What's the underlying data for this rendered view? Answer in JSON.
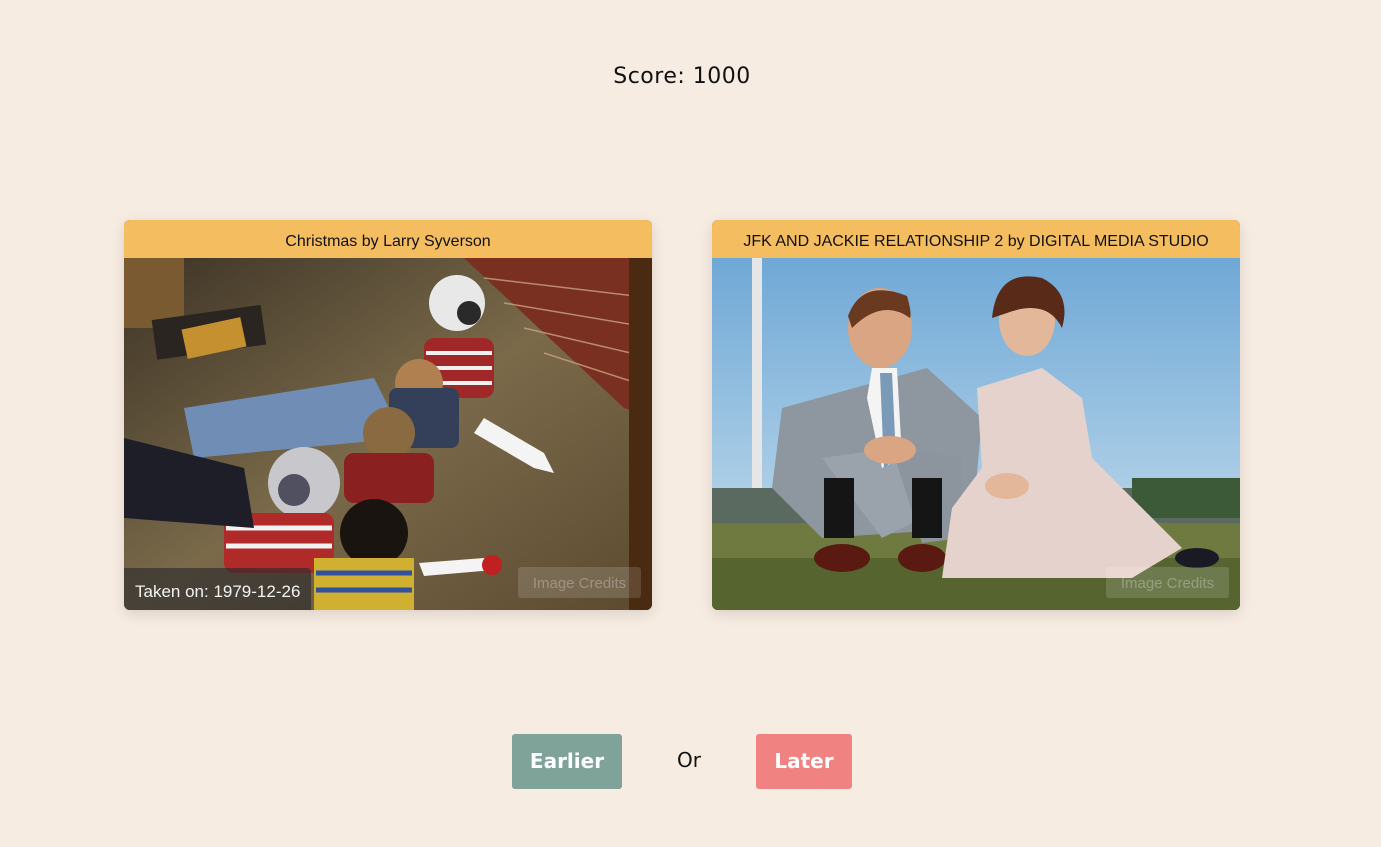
{
  "score": {
    "text": "Score: 1000"
  },
  "left_card": {
    "title": "Christmas by Larry Syverson",
    "date_text": "Taken on: 1979-12-26",
    "credits_label": "Image Credits"
  },
  "right_card": {
    "title": "JFK AND JACKIE RELATIONSHIP 2 by DIGITAL MEDIA STUDIO",
    "credits_label": "Image Credits"
  },
  "controls": {
    "earlier_label": "Earlier",
    "or_label": "Or",
    "later_label": "Later"
  },
  "colors": {
    "background": "#f7ece2",
    "card_header": "#f4bd60",
    "earlier_button": "#80a399",
    "later_button": "#f08381"
  }
}
